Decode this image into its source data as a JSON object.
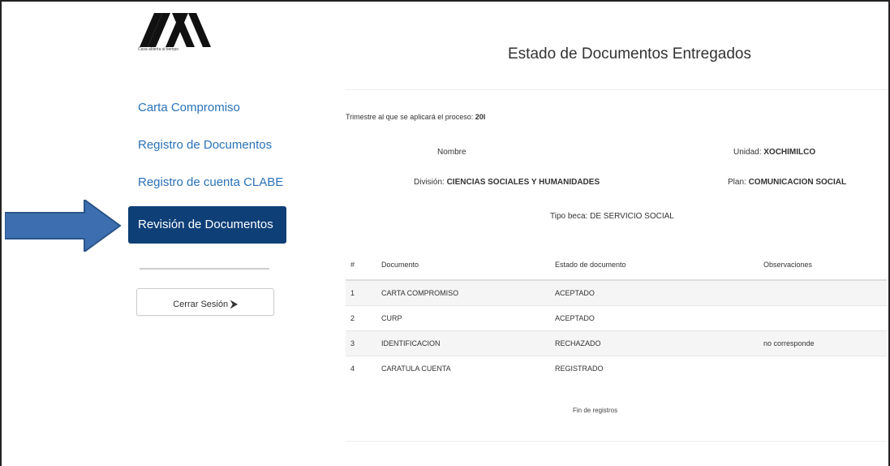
{
  "logo": {
    "caption": "Casa abierta al tiempo"
  },
  "sidebar": {
    "items": [
      {
        "label": "Carta Compromiso"
      },
      {
        "label": "Registro de Documentos"
      },
      {
        "label": "Registro de cuenta CLABE"
      },
      {
        "label": "Revisión de Documentos",
        "active": true
      }
    ],
    "logout_label": "Cerrar Sesión",
    "logout_icon": "sign-out-icon"
  },
  "main": {
    "title": "Estado de Documentos Entregados",
    "trimestre_label": "Trimestre al que se aplicará el proceso:",
    "trimestre_value": "20I",
    "nombre_label": "Nombre",
    "unidad_label": "Unidad:",
    "unidad_value": "XOCHIMILCO",
    "division_label": "División:",
    "division_value": "CIENCIAS SOCIALES Y HUMANIDADES",
    "plan_label": "Plan:",
    "plan_value": "COMUNICACION SOCIAL",
    "tipo_beca_label": "Tipo beca:",
    "tipo_beca_value": "DE SERVICIO SOCIAL",
    "table": {
      "headers": [
        "#",
        "Documento",
        "Estado de documento",
        "Observaciones"
      ],
      "rows": [
        [
          "1",
          "CARTA COMPROMISO",
          "ACEPTADO",
          ""
        ],
        [
          "2",
          "CURP",
          "ACEPTADO",
          ""
        ],
        [
          "3",
          "IDENTIFICACION",
          "RECHAZADO",
          "no corresponde"
        ],
        [
          "4",
          "CARATULA CUENTA",
          "REGISTRADO",
          ""
        ]
      ]
    },
    "footer_note": "Fin de registros"
  },
  "colors": {
    "accent": "#2a72b8",
    "active_bg": "#0e3f77",
    "arrow": "#3d6fb0"
  }
}
